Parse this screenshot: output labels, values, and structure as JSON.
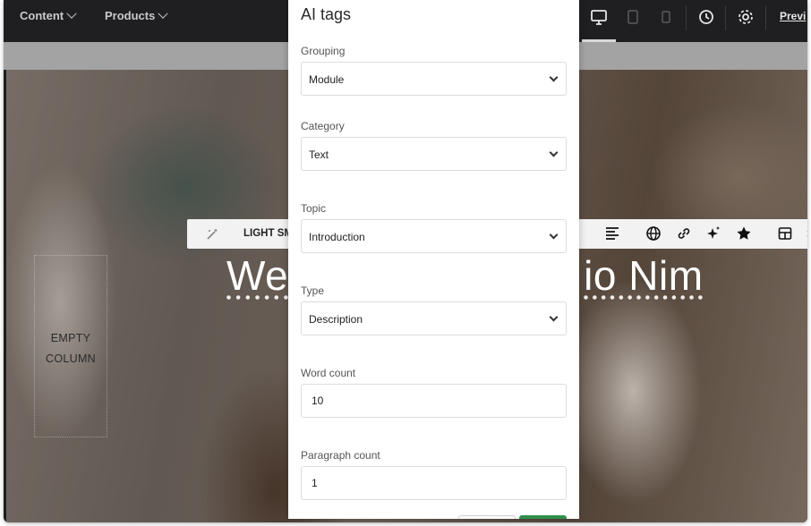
{
  "nav": {
    "content_label": "Content",
    "products_label": "Products",
    "preview_label": "Previ"
  },
  "toolbar": {
    "style_label": "LIGHT SM"
  },
  "hero": {
    "headline_left": "We",
    "headline_right": "io Nim",
    "empty_line1": "EMPTY",
    "empty_line2": "COLUMN"
  },
  "modal": {
    "title": "AI tags",
    "grouping": {
      "label": "Grouping",
      "value": "Module"
    },
    "category": {
      "label": "Category",
      "value": "Text"
    },
    "topic": {
      "label": "Topic",
      "value": "Introduction"
    },
    "type": {
      "label": "Type",
      "value": "Description"
    },
    "word_count": {
      "label": "Word count",
      "value": "10"
    },
    "paragraph_count": {
      "label": "Paragraph count",
      "value": "1"
    }
  },
  "colors": {
    "topbar": "#1f1f21",
    "accent_green": "#2f8f4e"
  }
}
